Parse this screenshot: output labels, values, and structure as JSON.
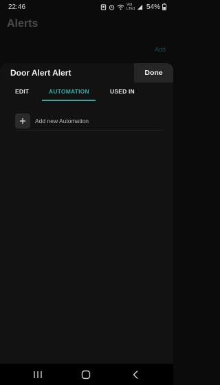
{
  "status_bar": {
    "time": "22:46",
    "network": "Vo) LTE1",
    "battery": "54%"
  },
  "background": {
    "title": "Alerts",
    "add_label": "Add"
  },
  "sheet": {
    "title": "Door Alert Alert",
    "done_label": "Done",
    "tabs": [
      {
        "label": "EDIT",
        "active": false
      },
      {
        "label": "AUTOMATION",
        "active": true
      },
      {
        "label": "USED IN",
        "active": false
      }
    ],
    "add_automation_label": "Add new Automation"
  },
  "colors": {
    "accent": "#35a9a3",
    "background": "#0b0b0b",
    "sheet": "#121212"
  },
  "icons": [
    "alarm-icon",
    "wifi-icon",
    "signal-icon",
    "battery-icon",
    "plus-icon",
    "recents-icon",
    "home-icon",
    "back-icon"
  ]
}
